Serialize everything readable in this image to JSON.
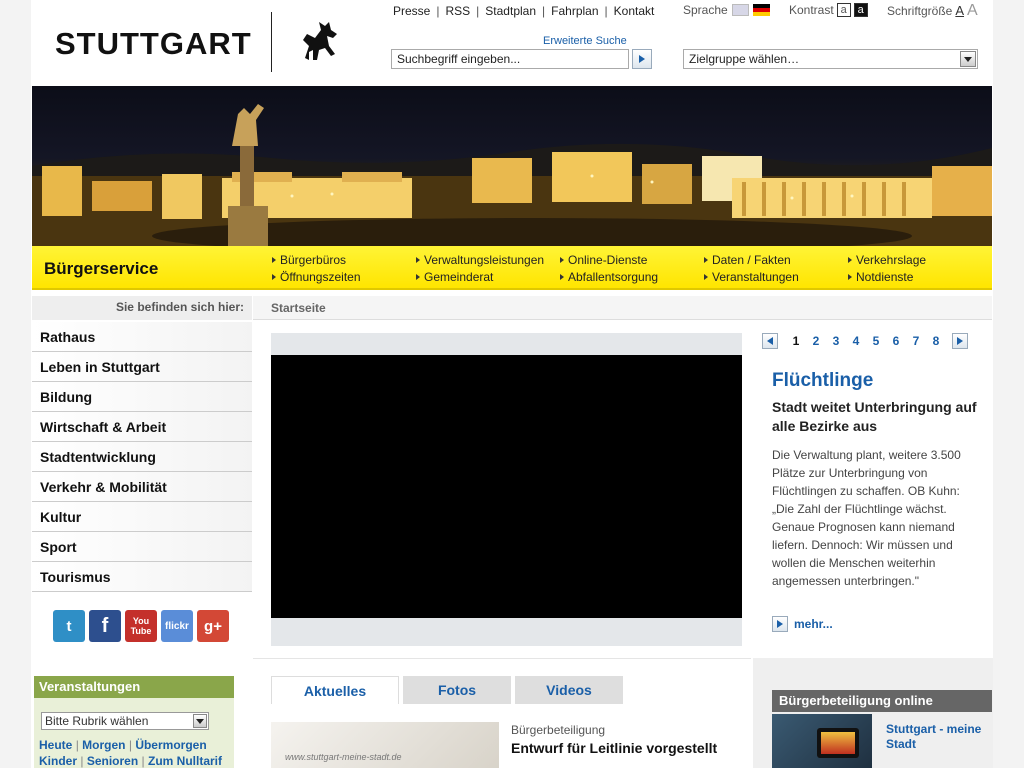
{
  "header": {
    "logo_text": "STUTTGART",
    "topnav": [
      "Presse",
      "RSS",
      "Stadtplan",
      "Fahrplan",
      "Kontakt"
    ],
    "sprache_label": "Sprache",
    "kontrast_label": "Kontrast",
    "kontrast_a": "a",
    "kontrast_b": "a",
    "schrift_label": "Schriftgröße",
    "schrift_a1": "A",
    "schrift_a2": "A",
    "erweiterte_suche": "Erweiterte Suche",
    "search_placeholder": "Suchbegriff eingeben...",
    "zielgruppe": "Zielgruppe wählen…"
  },
  "service": {
    "title": "Bürgerservice",
    "links": [
      [
        "Bürgerbüros",
        "Öffnungszeiten"
      ],
      [
        "Verwaltungsleistungen",
        "Gemeinderat"
      ],
      [
        "Online-Dienste",
        "Abfallentsorgung"
      ],
      [
        "Daten / Fakten",
        "Veranstaltungen"
      ],
      [
        "Verkehrslage",
        "Notdienste"
      ]
    ]
  },
  "breadcrumb": {
    "label": "Sie befinden sich hier:",
    "current": "Startseite"
  },
  "leftnav": [
    "Rathaus",
    "Leben in Stuttgart",
    "Bildung",
    "Wirtschaft & Arbeit",
    "Stadtentwicklung",
    "Verkehr & Mobilität",
    "Kultur",
    "Sport",
    "Tourismus"
  ],
  "social": [
    {
      "name": "twitter",
      "glyph": "t",
      "color": "#2f8fc6"
    },
    {
      "name": "facebook",
      "glyph": "f",
      "color": "#2d4f8e"
    },
    {
      "name": "youtube",
      "glyph": "You Tube",
      "color": "#c4302b"
    },
    {
      "name": "flickr",
      "glyph": "flickr",
      "color": "#5a8dd8"
    },
    {
      "name": "google-plus",
      "glyph": "g+",
      "color": "#d34836"
    }
  ],
  "veranstaltungen": {
    "title": "Veranstaltungen",
    "select": "Bitte Rubrik wählen",
    "links": [
      "Heute",
      "Morgen",
      "Übermorgen",
      "Kinder",
      "Senioren",
      "Zum Nulltarif"
    ]
  },
  "pager": {
    "pages": [
      "1",
      "2",
      "3",
      "4",
      "5",
      "6",
      "7",
      "8"
    ],
    "active": "1"
  },
  "news": {
    "title": "Flüchtlinge",
    "subtitle": "Stadt weitet Unterbringung auf alle Bezirke aus",
    "body": "Die Verwaltung plant, weitere 3.500 Plätze zur Unterbringung von Flüchtlingen zu schaffen. OB Kuhn: „Die Zahl der Flüchtlinge wächst. Genaue Prognosen kann niemand liefern. Dennoch: Wir müssen und wollen die Menschen weiterhin angemessen unterbringen.\"",
    "mehr": "mehr..."
  },
  "tabs": [
    "Aktuelles",
    "Fotos",
    "Videos"
  ],
  "teaser": {
    "image_text": "www.stuttgart-meine-stadt.de",
    "category": "Bürgerbeteiligung",
    "title": "Entwurf für Leitlinie vorgestellt"
  },
  "buergerbeteiligung": {
    "title": "Bürgerbeteiligung online",
    "link": "Stuttgart - meine Stadt"
  }
}
